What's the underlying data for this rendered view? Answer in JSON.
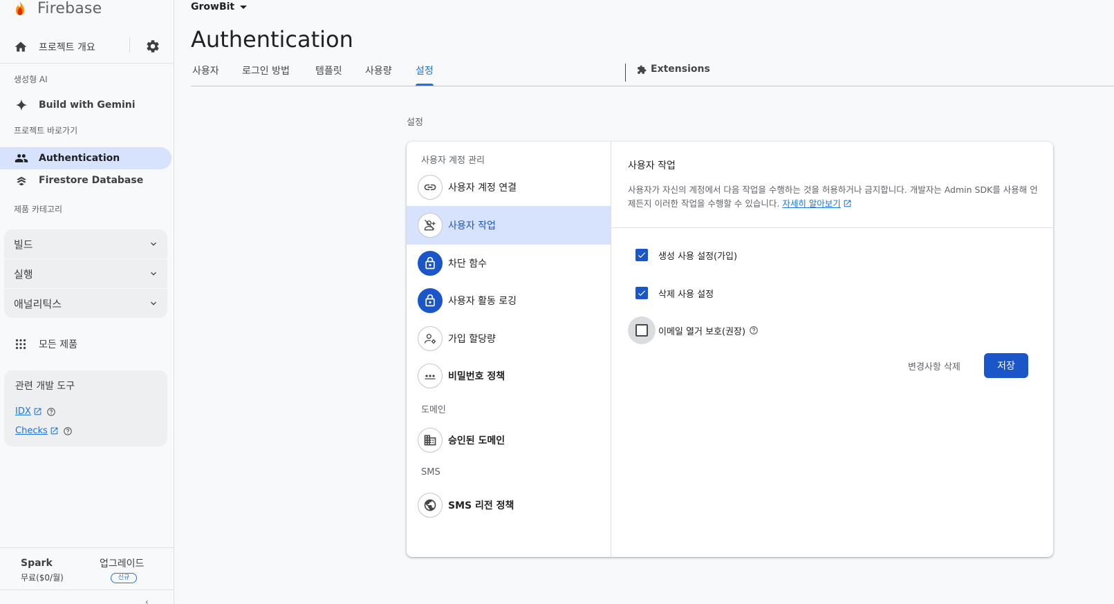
{
  "brand": {
    "name": "Firebase"
  },
  "sidebar": {
    "project_overview": "프로젝트 개요",
    "section_genai": "생성형 AI",
    "build_with_gemini": "Build with Gemini",
    "section_shortcuts": "프로젝트 바로가기",
    "shortcuts": [
      {
        "label": "Authentication",
        "active": true
      },
      {
        "label": "Firestore Database",
        "active": false
      }
    ],
    "section_categories": "제품 카테고리",
    "categories": [
      {
        "label": "빌드"
      },
      {
        "label": "실행"
      },
      {
        "label": "애널리틱스"
      }
    ],
    "all_products": "모든 제품",
    "dev_tools": {
      "title": "관련 개발 도구",
      "links": [
        {
          "label": "IDX"
        },
        {
          "label": "Checks"
        }
      ]
    },
    "plan": {
      "name": "Spark",
      "price": "무료($0/월)",
      "upgrade": "업그레이드",
      "badge": "신규"
    },
    "collapse_icon": "chevron-left-icon"
  },
  "header": {
    "project": "GrowBit",
    "title": "Authentication",
    "tabs": [
      {
        "label": "사용자",
        "active": false
      },
      {
        "label": "로그인 방법",
        "active": false
      },
      {
        "label": "템플릿",
        "active": false
      },
      {
        "label": "사용량",
        "active": false
      },
      {
        "label": "설정",
        "active": true
      }
    ],
    "extensions_tab": "Extensions"
  },
  "settings": {
    "label": "설정",
    "groups": [
      {
        "label": "사용자 계정 관리",
        "items": [
          {
            "label": "사용자 계정 연결",
            "icon": "link-icon"
          },
          {
            "label": "사용자 작업",
            "icon": "user-action-icon",
            "active": true
          },
          {
            "label": "차단 함수",
            "icon": "lock-icon"
          },
          {
            "label": "사용자 활동 로깅",
            "icon": "lock-icon"
          },
          {
            "label": "가입 할당량",
            "icon": "user-settings-icon"
          },
          {
            "label": "비밀번호 정책",
            "icon": "password-dots-icon"
          }
        ]
      },
      {
        "label": "도메인",
        "items": [
          {
            "label": "승인된 도메인",
            "icon": "domain-building-icon"
          }
        ]
      },
      {
        "label": "SMS",
        "items": [
          {
            "label": "SMS 리전 정책",
            "icon": "globe-icon"
          }
        ]
      }
    ],
    "detail": {
      "title": "사용자 작업",
      "description": "사용자가 자신의 계정에서 다음 작업을 수행하는 것을 허용하거나 금지합니다. 개발자는 Admin SDK를 사용해 언제든지 이러한 작업을 수행할 수 있습니다.",
      "learn_more": "자세히 알아보기",
      "options": [
        {
          "label": "생성 사용 설정(가입)",
          "checked": true
        },
        {
          "label": "삭제 사용 설정",
          "checked": true
        },
        {
          "label": "이메일 열거 보호(권장)",
          "checked": false
        }
      ],
      "discard_label": "변경사항 삭제",
      "save_label": "저장"
    }
  },
  "colors": {
    "accent": "#1a56c8",
    "active_bg": "#d7e3fc",
    "link": "#1a73e8"
  }
}
